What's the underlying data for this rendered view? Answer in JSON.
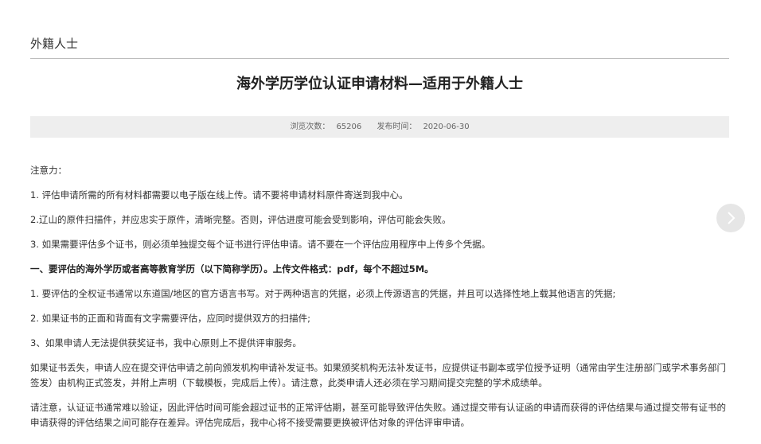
{
  "section": {
    "title": "外籍人士"
  },
  "article": {
    "title": "海外学历学位认证申请材料—适用于外籍人士",
    "views_label": "浏览次数：",
    "views_count": "65206",
    "date_label": "发布时间：",
    "date": "2020-06-30"
  },
  "content": {
    "notice": "注意力：",
    "p1": "1. 评估申请所需的所有材料都需要以电子版在线上传。请不要将申请材料原件寄送到我中心。",
    "p2": "2.辽山的原件扫描件，并应忠实于原件，清晰完整。否则，评估进度可能会受到影响，评估可能会失败。",
    "p3": "3. 如果需要评估多个证书，则必须单独提交每个证书进行评估申请。请不要在一个评估应用程序中上传多个凭据。",
    "heading1": "一、要评估的海外学历或者高等教育学历（以下简称学历）。上传文件格式：pdf，每个不超过5M。",
    "p4": "1. 要评估的全权证书通常以东道国/地区的官方语言书写。对于两种语言的凭据，必须上传源语言的凭据，并且可以选择性地上载其他语言的凭据;",
    "p5": "2. 如果证书的正面和背面有文字需要评估，应同时提供双方的扫描件;",
    "p6": "3、如果申请人无法提供获奖证书，我中心原则上不提供评审服务。",
    "p7": "如果证书丢失，申请人应在提交评估申请之前向颁发机构申请补发证书。如果颁奖机构无法补发证书，应提供证书副本或学位授予证明（通常由学生注册部门或学术事务部门签发）由机构正式签发，并附上声明（下载模板，完成后上传）。请注意，此类申请人还必须在学习期间提交完整的学术成绩单。",
    "p8": "请注意，认证证书通常难以验证，因此评估时间可能会超过证书的正常评估期，甚至可能导致评估失败。通过提交带有认证函的申请而获得的评估结果与通过提交带有证书的申请获得的评估结果之间可能存在差异。评估完成后，我中心将不接受需要更换被评估对象的评估评审申请。"
  },
  "icons": {
    "next": "chevron-right-icon"
  }
}
